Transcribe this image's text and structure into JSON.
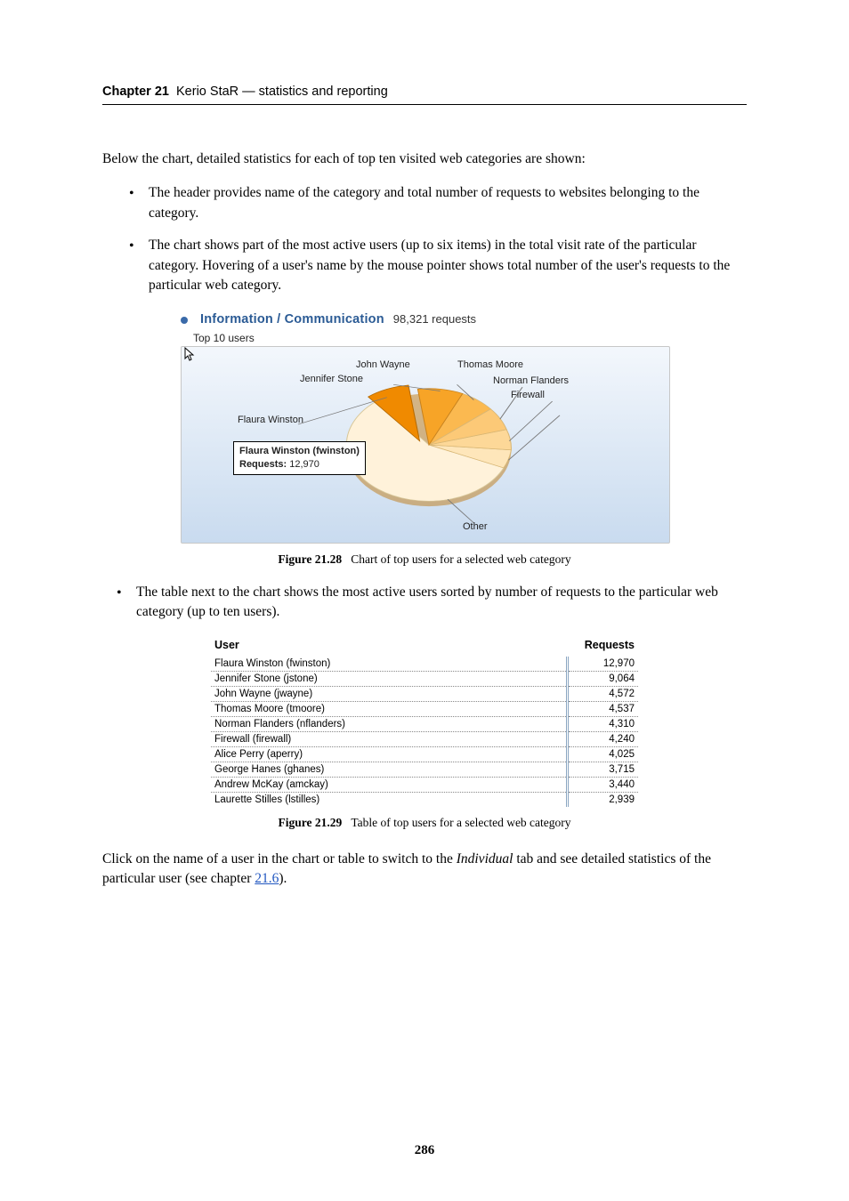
{
  "running_head": {
    "chapter": "Chapter 21",
    "title": "Kerio StaR — statistics and reporting"
  },
  "intro_text": "Below the chart, detailed statistics for each of top ten visited web categories are shown:",
  "bullets": [
    "The header provides name of the category and total number of requests to websites belonging to the category.",
    "The chart shows part of the most active users (up to six items) in the total visit rate of the particular category. Hovering of a user's name by the mouse pointer shows total number of the user's requests to the particular web category."
  ],
  "category": {
    "title": "Information / Communication",
    "requests_label": "98,321 requests"
  },
  "top10_label": "Top 10 users",
  "labels": {
    "john": "John Wayne",
    "jennifer": "Jennifer Stone",
    "flaura": "Flaura Winston",
    "thomas": "Thomas Moore",
    "norman": "Norman Flanders",
    "firewall": "Firewall",
    "other": "Other"
  },
  "tooltip": {
    "name": "Flaura Winston (fwinston)",
    "requests_label": "Requests:",
    "requests_value": "12,970"
  },
  "fig28_caption": {
    "num": "Figure 21.28",
    "text": "Chart of top users for a selected web category"
  },
  "bullet_after": "The table next to the chart shows the most active users sorted by number of requests to the particular web category (up to ten users).",
  "table": {
    "head": {
      "user": "User",
      "requests": "Requests"
    },
    "rows": [
      {
        "user": "Flaura Winston (fwinston)",
        "requests": "12,970"
      },
      {
        "user": "Jennifer Stone (jstone)",
        "requests": "9,064"
      },
      {
        "user": "John Wayne (jwayne)",
        "requests": "4,572"
      },
      {
        "user": "Thomas Moore (tmoore)",
        "requests": "4,537"
      },
      {
        "user": "Norman Flanders (nflanders)",
        "requests": "4,310"
      },
      {
        "user": "Firewall (firewall)",
        "requests": "4,240"
      },
      {
        "user": "Alice Perry (aperry)",
        "requests": "4,025"
      },
      {
        "user": "George Hanes (ghanes)",
        "requests": "3,715"
      },
      {
        "user": "Andrew McKay (amckay)",
        "requests": "3,440"
      },
      {
        "user": "Laurette Stilles (lstilles)",
        "requests": "2,939"
      }
    ]
  },
  "fig29_caption": {
    "num": "Figure 21.29",
    "text": "Table of top users for a selected web category"
  },
  "after": {
    "pre": "Click on the name of a user in the chart or table to switch to the ",
    "individual": "Individual",
    "mid": " tab and see detailed statistics of the particular user (see chapter ",
    "link": "21.6",
    "post": ")."
  },
  "page_number": "286",
  "chart_data": {
    "type": "pie",
    "title": "Information / Communication — Top 10 users",
    "total_requests": 98321,
    "series": [
      {
        "name": "Flaura Winston",
        "value": 12970,
        "color": "#f08a00"
      },
      {
        "name": "Jennifer Stone",
        "value": 9064,
        "color": "#f7a427"
      },
      {
        "name": "John Wayne",
        "value": 4572,
        "color": "#fbb950"
      },
      {
        "name": "Thomas Moore",
        "value": 4537,
        "color": "#fcc977"
      },
      {
        "name": "Norman Flanders",
        "value": 4310,
        "color": "#fdd898"
      },
      {
        "name": "Firewall",
        "value": 4240,
        "color": "#fee6ba"
      },
      {
        "name": "Other",
        "value": 58628,
        "color": "#fff2da"
      }
    ]
  }
}
